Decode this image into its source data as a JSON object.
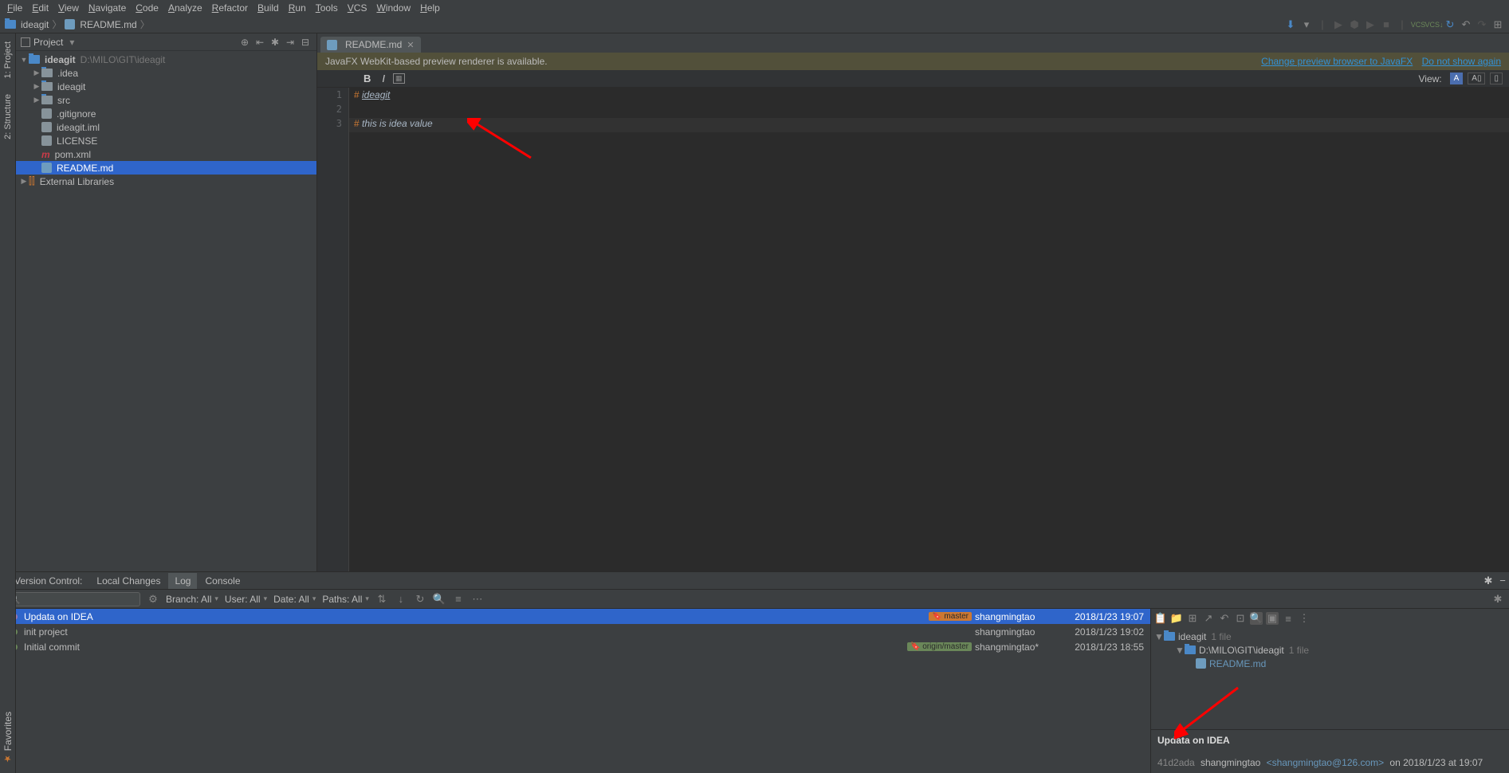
{
  "menu": [
    "File",
    "Edit",
    "View",
    "Navigate",
    "Code",
    "Analyze",
    "Refactor",
    "Build",
    "Run",
    "Tools",
    "VCS",
    "Window",
    "Help"
  ],
  "breadcrumb": {
    "root": "ideagit",
    "file": "README.md"
  },
  "project_panel": {
    "title": "Project"
  },
  "tree": {
    "root": "ideagit",
    "root_path": "D:\\MILO\\GIT\\ideagit",
    "nodes": [
      {
        "indent": 1,
        "arrow": "▶",
        "ico": "folder",
        "name": ".idea"
      },
      {
        "indent": 1,
        "arrow": "▶",
        "ico": "folder",
        "name": "ideagit"
      },
      {
        "indent": 1,
        "arrow": "▶",
        "ico": "folder",
        "name": "src"
      },
      {
        "indent": 1,
        "arrow": "",
        "ico": "file",
        "name": ".gitignore"
      },
      {
        "indent": 1,
        "arrow": "",
        "ico": "file",
        "name": "ideagit.iml"
      },
      {
        "indent": 1,
        "arrow": "",
        "ico": "file",
        "name": "LICENSE"
      },
      {
        "indent": 1,
        "arrow": "",
        "ico": "m",
        "name": "pom.xml"
      },
      {
        "indent": 1,
        "arrow": "",
        "ico": "md",
        "name": "README.md",
        "sel": true
      }
    ],
    "ext": "External Libraries"
  },
  "editor": {
    "tab": "README.md",
    "banner": "JavaFX WebKit-based preview renderer is available.",
    "banner_link1": "Change preview browser to JavaFX",
    "banner_link2": "Do not show again",
    "view_label": "View:",
    "lines": [
      {
        "n": "1",
        "pfx": "# ",
        "txt": "ideagit",
        "u": true
      },
      {
        "n": "2",
        "pfx": "",
        "txt": ""
      },
      {
        "n": "3",
        "pfx": "# ",
        "txt": "this is idea value",
        "cur": true
      }
    ]
  },
  "vc": {
    "title": "Version Control:",
    "tabs": [
      "Local Changes",
      "Log",
      "Console"
    ],
    "active_tab": "Log",
    "filters": {
      "branch": "Branch: All",
      "user": "User: All",
      "date": "Date: All",
      "paths": "Paths: All"
    },
    "commits": [
      {
        "msg": "Updata on IDEA",
        "tag": "master",
        "tagtype": "local",
        "author": "shangmingtao",
        "date": "2018/1/23 19:07",
        "sel": true
      },
      {
        "msg": "init project",
        "author": "shangmingtao",
        "date": "2018/1/23 19:02"
      },
      {
        "msg": "Initial commit",
        "tag": "origin/master",
        "tagtype": "remote",
        "author": "shangmingtao*",
        "date": "2018/1/23 18:55"
      }
    ],
    "details": {
      "root": "ideagit",
      "root_count": "1 file",
      "path": "D:\\MILO\\GIT\\ideagit",
      "path_count": "1 file",
      "file": "README.md",
      "title": "Updata on IDEA",
      "hash": "41d2ada",
      "author": "shangmingtao",
      "email": "<shangmingtao@126.com>",
      "when": "on 2018/1/23 at 19:07"
    }
  },
  "sidebars": {
    "project": "1: Project",
    "structure": "2: Structure",
    "favorites": "Favorites"
  }
}
